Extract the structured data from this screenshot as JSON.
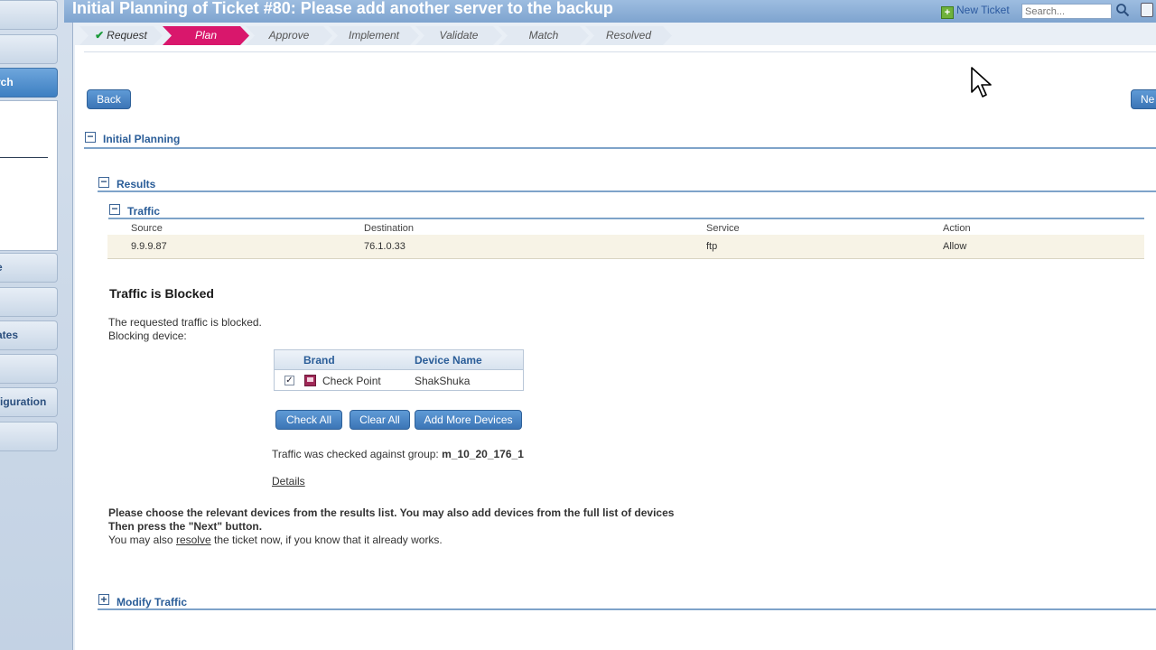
{
  "window": {
    "title": "Initial Planning of Ticket #80: Please add another server to the backup"
  },
  "header": {
    "new_ticket_label": "New Ticket",
    "search_placeholder": "Search...",
    "icons": [
      "new-ticket-icon",
      "search-icon",
      "logout-icon"
    ]
  },
  "sidebar": {
    "items": [
      {
        "label": ""
      },
      {
        "label": ""
      },
      {
        "label": "rch",
        "active": true
      },
      {
        "label": "e"
      },
      {
        "label": ""
      },
      {
        "label": "ates"
      },
      {
        "label": ""
      },
      {
        "label": "figuration"
      },
      {
        "label": ""
      }
    ]
  },
  "workflow": {
    "steps": [
      "Request",
      "Plan",
      "Approve",
      "Implement",
      "Validate",
      "Match",
      "Resolved"
    ],
    "completed": [
      "Request"
    ],
    "current": "Plan"
  },
  "nav": {
    "back_label": "Back",
    "next_label": "Ne"
  },
  "sections": {
    "initial_planning": "Initial Planning",
    "results": "Results",
    "traffic": "Traffic",
    "modify_traffic": "Modify Traffic"
  },
  "traffic_table": {
    "columns": [
      "Source",
      "Destination",
      "Service",
      "Action"
    ],
    "rows": [
      {
        "source": "9.9.9.87",
        "destination": "76.1.0.33",
        "service": "ftp",
        "action": "Allow"
      }
    ]
  },
  "blocked": {
    "title": "Traffic is Blocked",
    "line1": "The requested traffic is blocked.",
    "line2": "Blocking device:"
  },
  "devices_table": {
    "columns": [
      "Brand",
      "Device Name"
    ],
    "rows": [
      {
        "checked": true,
        "check_mark": "✓",
        "brand": "Check Point",
        "device_name": "ShakShuka"
      }
    ]
  },
  "device_buttons": {
    "check_all": "Check All",
    "clear_all": "Clear All",
    "add_more": "Add More Devices"
  },
  "group_check": {
    "prefix": "Traffic was checked against group:",
    "group": "m_10_20_176_1"
  },
  "details_link": "Details",
  "instructions": {
    "line1": "Please choose the relevant devices from the results list. You may also add devices from the full list of devices",
    "line2": "Then press the \"Next\" button.",
    "line3_prefix": "You may also",
    "resolve_link": "resolve",
    "line3_suffix": "the ticket now, if you know that it already works."
  },
  "colors": {
    "current_step": "#d9176c",
    "button": "#3b75b6",
    "section_header": "#2a5d98",
    "traffic_row_bg": "#f7f3e6"
  }
}
